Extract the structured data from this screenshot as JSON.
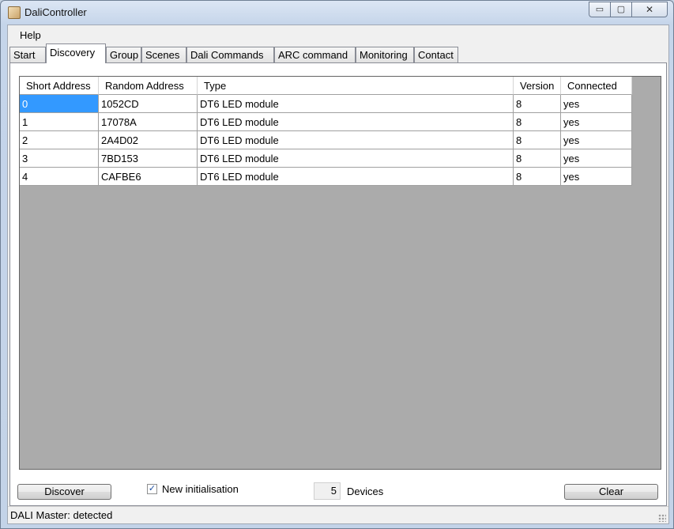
{
  "window": {
    "title": "DaliController",
    "controls": {
      "minimize": "▭",
      "maximize": "▢",
      "close": "✕"
    }
  },
  "menu": {
    "items": [
      "Help"
    ]
  },
  "tabs": [
    {
      "label": "Start"
    },
    {
      "label": "Discovery",
      "active": true
    },
    {
      "label": "Group"
    },
    {
      "label": "Scenes"
    },
    {
      "label": "Dali Commands"
    },
    {
      "label": "ARC command"
    },
    {
      "label": "Monitoring"
    },
    {
      "label": "Contact"
    }
  ],
  "grid": {
    "columns": [
      "Short Address",
      "Random Address",
      "Type",
      "Version",
      "Connected"
    ],
    "rows": [
      [
        "0",
        "1052CD",
        "DT6 LED module",
        "8",
        "yes"
      ],
      [
        "1",
        "17078A",
        "DT6 LED module",
        "8",
        "yes"
      ],
      [
        "2",
        "2A4D02",
        "DT6 LED module",
        "8",
        "yes"
      ],
      [
        "3",
        "7BD153",
        "DT6 LED module",
        "8",
        "yes"
      ],
      [
        "4",
        "CAFBE6",
        "DT6 LED module",
        "8",
        "yes"
      ]
    ],
    "selected_row": 0
  },
  "controls": {
    "discover_label": "Discover",
    "new_init_label": "New initialisation",
    "new_init_checked": true,
    "device_count": "5",
    "devices_label": "Devices",
    "clear_label": "Clear"
  },
  "status": {
    "text": "DALI Master: detected"
  },
  "colors": {
    "selection": "#3399ff",
    "grid_background": "#ababab"
  }
}
